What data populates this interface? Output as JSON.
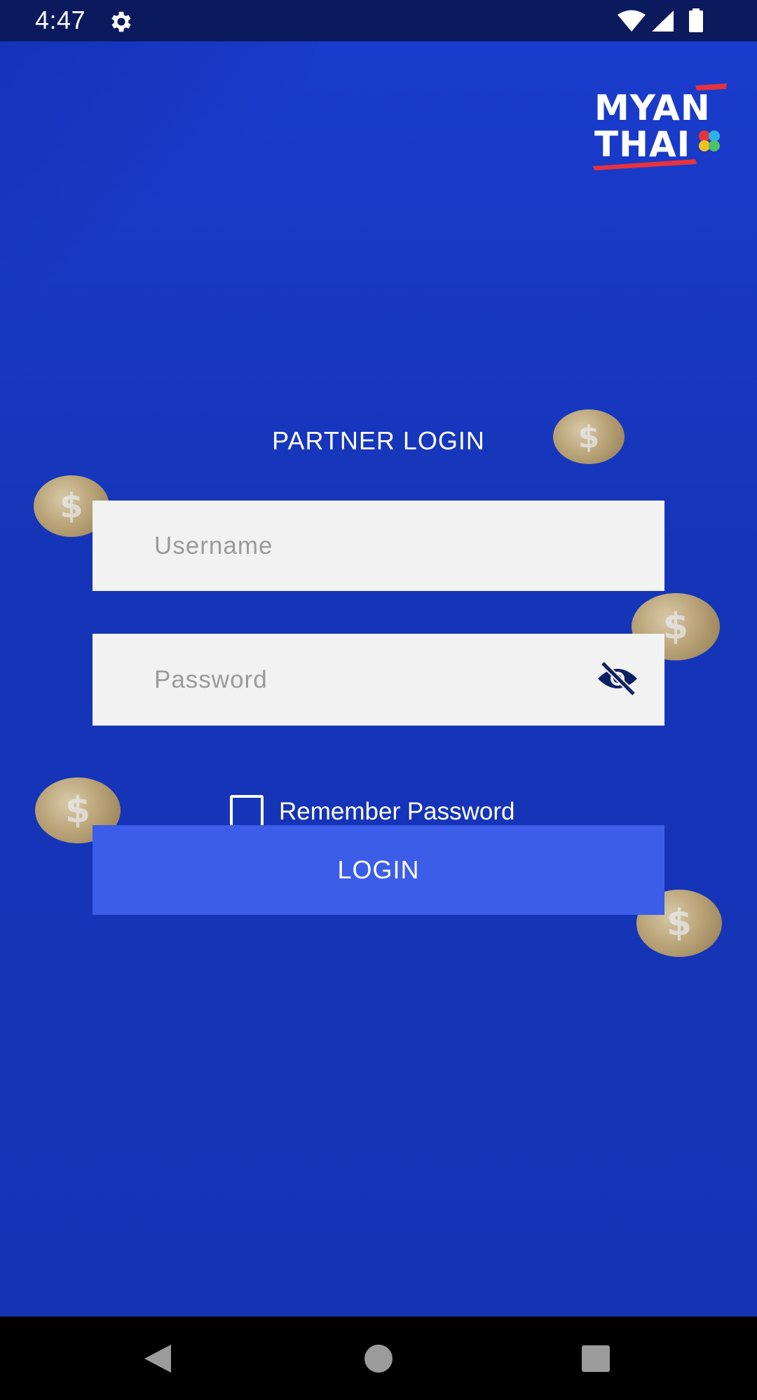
{
  "status_bar": {
    "time": "4:47",
    "icons": [
      "gear-icon",
      "wifi-icon",
      "signal-icon",
      "battery-icon"
    ]
  },
  "logo": {
    "line1": "MYAN",
    "line2": "THAI",
    "colors": {
      "text": "#ffffff",
      "accent": "#e8323c"
    }
  },
  "login_form": {
    "title": "PARTNER LOGIN",
    "username": {
      "placeholder": "Username",
      "value": ""
    },
    "password": {
      "placeholder": "Password",
      "value": "",
      "toggle_icon": "eye-off-icon"
    },
    "remember": {
      "label": "Remember Password",
      "checked": false
    },
    "login_button": "LOGIN"
  },
  "decor": {
    "coin_symbol": "$"
  },
  "nav_bar": {
    "icons": [
      "back-icon",
      "home-icon",
      "recents-icon"
    ]
  },
  "colors": {
    "background": "#1534b6",
    "status_bar": "#0a1a5c",
    "button": "#3b5de8",
    "field": "#f2f2f2"
  }
}
